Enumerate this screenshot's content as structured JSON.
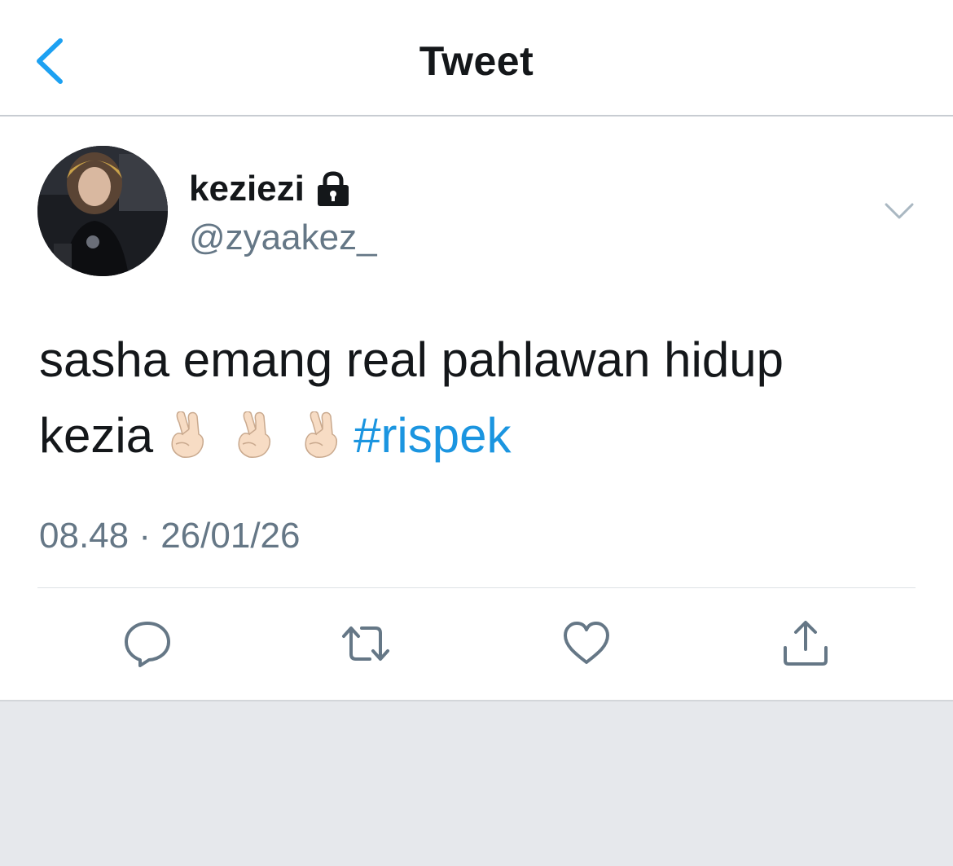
{
  "header": {
    "title": "Tweet",
    "back_icon": "chevron-left-icon"
  },
  "tweet": {
    "author": {
      "display_name": "keziezi",
      "handle": "@zyaakez_",
      "protected": true
    },
    "text_line1": "sasha emang real pahlawan hidup",
    "text_line2_prefix": "kezia",
    "emoji": [
      "🤞🏻",
      "🤞🏻",
      "🤞🏻"
    ],
    "hashtag": "#rispek",
    "timestamp": "08.48 · 26/01/26"
  },
  "actions": [
    "reply-icon",
    "retweet-icon",
    "like-icon",
    "share-icon"
  ],
  "colors": {
    "accent": "#1da1f2",
    "hashtag": "#1b95e0",
    "text": "#14171a",
    "secondary": "#657786",
    "background_bottom": "#e6e8ec"
  }
}
